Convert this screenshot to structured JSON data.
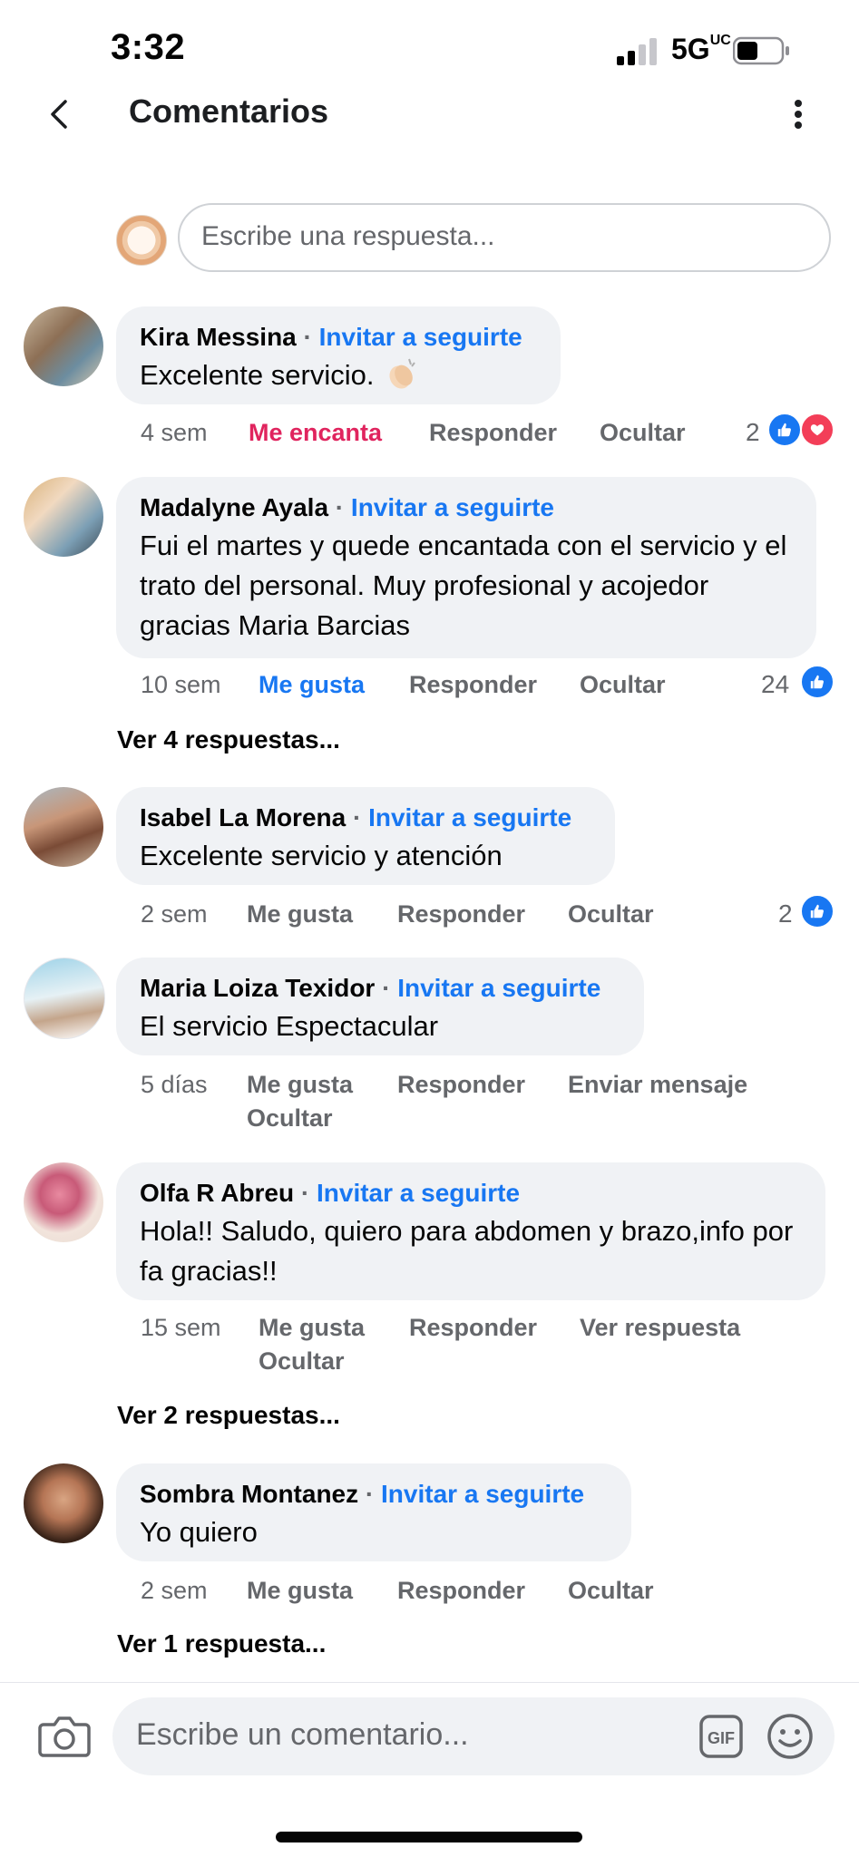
{
  "status_bar": {
    "time": "3:32",
    "network": "5G",
    "network_sup": "UC"
  },
  "header": {
    "title": "Comentarios"
  },
  "reply_box": {
    "placeholder": "Escribe una respuesta..."
  },
  "comments": [
    {
      "author": "Kira Messina",
      "invite": "Invitar a seguirte",
      "text": "Excelente servicio.",
      "time": "4 sem",
      "react_label": "Me encanta",
      "reply": "Responder",
      "hide": "Ocultar",
      "reactions": "2"
    },
    {
      "author": "Madalyne Ayala",
      "invite": "Invitar a seguirte",
      "text": "Fui el martes y quede encantada con el servicio y el trato del personal. Muy profesional y acojedor gracias Maria Barcias",
      "time": "10 sem",
      "react_label": "Me gusta",
      "reply": "Responder",
      "hide": "Ocultar",
      "reactions": "24",
      "more": "Ver 4 respuestas..."
    },
    {
      "author": "Isabel La Morena",
      "invite": "Invitar a seguirte",
      "text": "Excelente servicio y atención",
      "time": "2 sem",
      "react_label": "Me gusta",
      "reply": "Responder",
      "hide": "Ocultar",
      "reactions": "2"
    },
    {
      "author": "Maria Loiza Texidor",
      "invite": "Invitar a seguirte",
      "text": "El servicio Espectacular",
      "time": "5 días",
      "react_label": "Me gusta",
      "reply": "Responder",
      "extra": "Enviar mensaje",
      "hide": "Ocultar"
    },
    {
      "author": "Olfa R Abreu",
      "invite": "Invitar a seguirte",
      "text": "Hola!! Saludo, quiero para abdomen y brazo,info por fa gracias!!",
      "time": "15 sem",
      "react_label": "Me gusta",
      "reply": "Responder",
      "extra": "Ver respuesta",
      "hide": "Ocultar",
      "more": "Ver 2 respuestas..."
    },
    {
      "author": "Sombra Montanez",
      "invite": "Invitar a seguirte",
      "text": "Yo quiero",
      "time": "2 sem",
      "react_label": "Me gusta",
      "reply": "Responder",
      "hide": "Ocultar",
      "more": "Ver 1 respuesta..."
    }
  ],
  "composer": {
    "placeholder": "Escribe un comentario...",
    "gif_label": "GIF"
  },
  "colors": {
    "link": "#1877f2",
    "love": "#e0245e",
    "bubble": "#f0f2f5",
    "muted": "#65676b"
  },
  "icons": [
    "back-arrow-icon",
    "more-vertical-icon",
    "like-icon",
    "heart-icon",
    "camera-icon",
    "gif-icon",
    "emoji-icon",
    "clap-emoji-icon"
  ]
}
